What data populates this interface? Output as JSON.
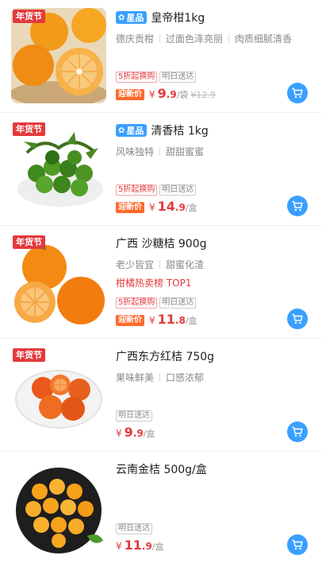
{
  "colors": {
    "price_red": "#e4393c",
    "accent_blue": "#3aa0ff",
    "promo_orange": "#ff6a2c"
  },
  "products": [
    {
      "festival_tag": "年货节",
      "star_badge": "星品",
      "title": "皇帝柑1kg",
      "subtitles": [
        "德庆贡柑",
        "过面色泽亮丽",
        "肉质细腻清香"
      ],
      "badges": [
        "5折起换购",
        "明日送达"
      ],
      "promo_label": "迎新价",
      "currency": "¥",
      "price_int": "9",
      "price_dec": ".9",
      "unit": "/袋",
      "original_price": "¥12.9",
      "cart_icon": "cart-icon"
    },
    {
      "festival_tag": "年货节",
      "star_badge": "星品",
      "title": "清香桔 1kg",
      "subtitles": [
        "风味独特",
        "甜甜蜜蜜"
      ],
      "badges": [
        "5折起换购",
        "明日送达"
      ],
      "promo_label": "迎新价",
      "currency": "¥",
      "price_int": "14",
      "price_dec": ".9",
      "unit": "/盒",
      "cart_icon": "cart-icon"
    },
    {
      "festival_tag": "年货节",
      "title": "广西 沙糖桔 900g",
      "subtitles": [
        "老少皆宜",
        "甜蜜化渣"
      ],
      "hot_text": "柑橘热卖榜 TOP1",
      "badges": [
        "5折起换购",
        "明日送达"
      ],
      "promo_label": "迎新价",
      "currency": "¥",
      "price_int": "11",
      "price_dec": ".8",
      "unit": "/盒",
      "cart_icon": "cart-icon"
    },
    {
      "festival_tag": "年货节",
      "title": "广西东方红桔 750g",
      "subtitles": [
        "果味鲜美",
        "口感浓郁"
      ],
      "badges": [
        "明日送达"
      ],
      "currency": "¥",
      "price_int": "9",
      "price_dec": ".9",
      "unit": "/盒",
      "cart_icon": "cart-icon"
    },
    {
      "title": "云南金桔 500g/盒",
      "badges": [
        "明日送达"
      ],
      "currency": "¥",
      "price_int": "11",
      "price_dec": ".9",
      "unit": "/盒",
      "cart_icon": "cart-icon"
    }
  ]
}
